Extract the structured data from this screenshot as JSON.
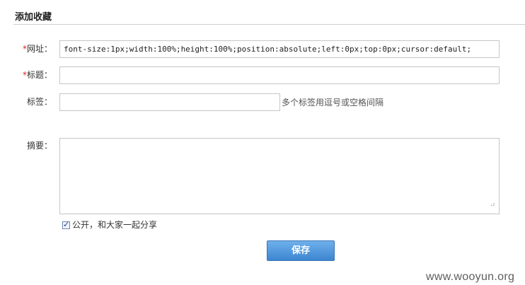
{
  "form": {
    "title": "添加收藏",
    "url": {
      "required_mark": "*",
      "label": "网址：",
      "value": "font-size:1px;width:100%;height:100%;position:absolute;left:0px;top:0px;cursor:default;"
    },
    "title_field": {
      "required_mark": "*",
      "label": "标题：",
      "value": ""
    },
    "tags": {
      "label": "标签：",
      "value": "",
      "hint": "多个标签用逗号或空格间隔"
    },
    "summary": {
      "label": "摘要：",
      "value": ""
    },
    "public_share": {
      "checked": true,
      "label": "公开，和大家一起分享"
    },
    "save_label": "保存"
  },
  "watermark": "www.wooyun.org",
  "colors": {
    "required": "#d9251c",
    "button": "#3c86d1",
    "border": "#c6c6c6"
  }
}
